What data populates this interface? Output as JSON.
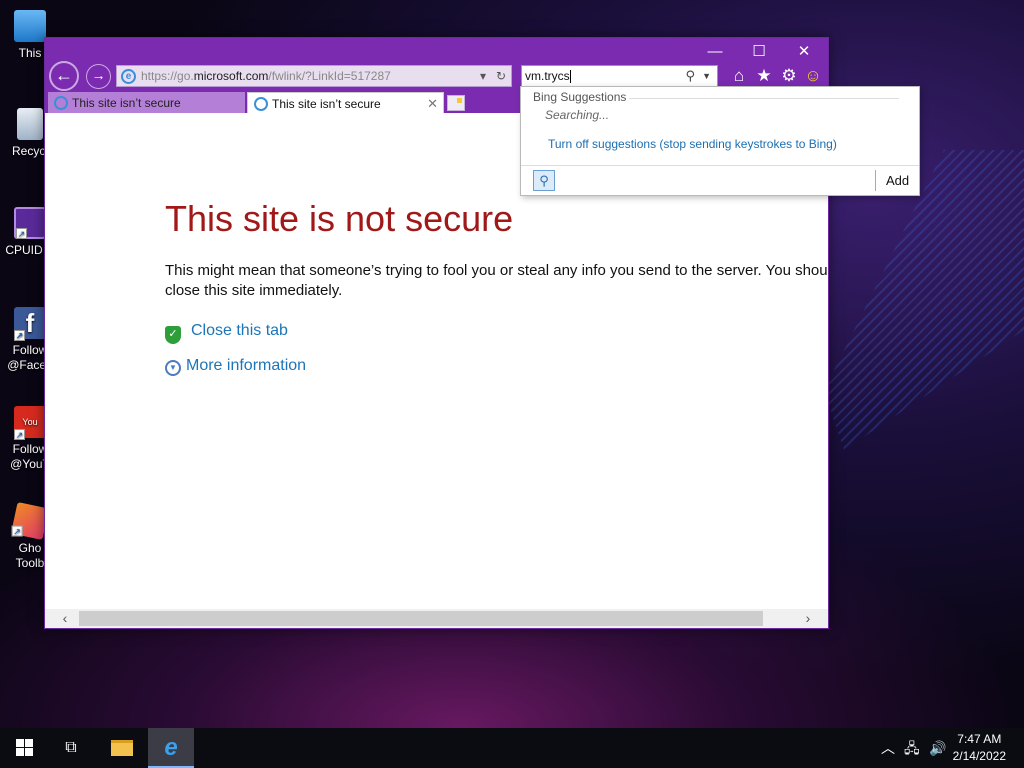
{
  "desktop": {
    "icons": [
      {
        "label": "This"
      },
      {
        "label": "Recycl"
      },
      {
        "label": "CPUID C"
      },
      {
        "label": "Follow\n@Faceb"
      },
      {
        "label": "Follow\n@YouT"
      },
      {
        "label": "Gho\nToolb"
      }
    ]
  },
  "browser": {
    "window_controls": {
      "minimize": "—",
      "maximize": "☐",
      "close": "✕"
    },
    "address": {
      "prefix": "https://go.",
      "host": "microsoft.com",
      "path": "/fwlink/?LinkId=517287"
    },
    "search": {
      "value": "vm.trycs"
    },
    "tabs": [
      {
        "title": "This site isn’t secure"
      },
      {
        "title": "This site isn’t secure"
      }
    ]
  },
  "page": {
    "title": "This site is not secure",
    "description": "This might mean that someone’s trying to fool you or steal any info you send to the server. You should close this site immediately.",
    "close_tab_label": "Close this tab",
    "more_info_label": "More information"
  },
  "suggestions": {
    "heading": "Bing Suggestions",
    "status": "Searching...",
    "turn_off_label": "Turn off suggestions (stop sending keystrokes to Bing)",
    "add_label": "Add"
  },
  "taskbar": {
    "time": "7:47 AM",
    "date": "2/14/2022"
  },
  "colors": {
    "titlebar": "#7a2bb0",
    "error_title": "#a01818",
    "link": "#1c75b8"
  }
}
